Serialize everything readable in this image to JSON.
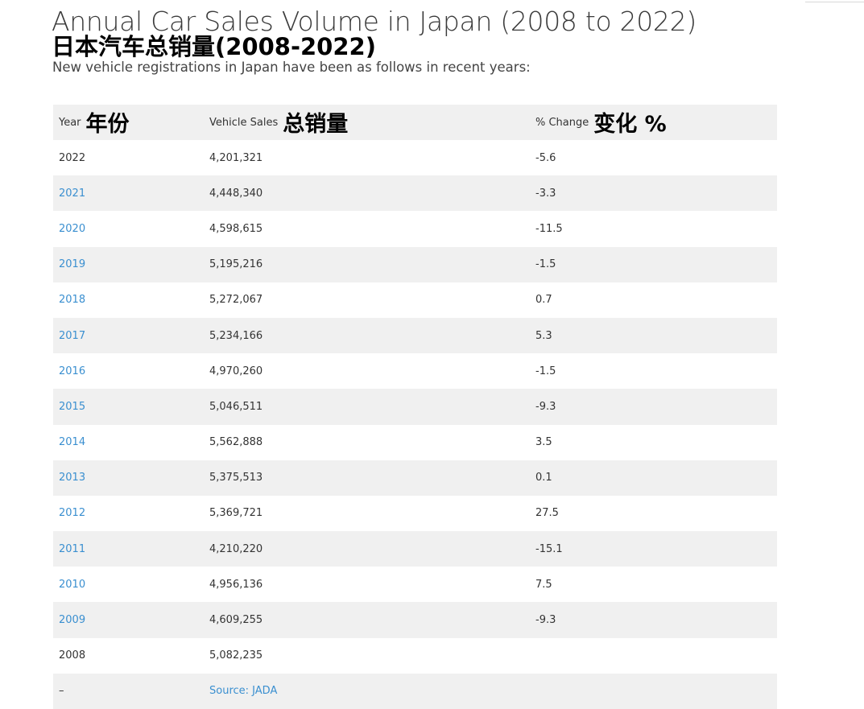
{
  "page": {
    "title": "Annual Car Sales Volume in Japan (2008 to 2022)",
    "title_cn": "日本汽车总销量(2008-2022)",
    "intro": "New vehicle registrations in Japan have been as follows in recent years:"
  },
  "table": {
    "headers": [
      {
        "en": "Year",
        "cn": "年份"
      },
      {
        "en": "Vehicle Sales",
        "cn": "总销量"
      },
      {
        "en": "% Change",
        "cn": "变化 %"
      }
    ],
    "rows": [
      {
        "year": "2022",
        "sales": "4,201,321",
        "change": "-5.6",
        "year_is_link": false
      },
      {
        "year": "2021",
        "sales": "4,448,340",
        "change": "-3.3",
        "year_is_link": true
      },
      {
        "year": "2020",
        "sales": "4,598,615",
        "change": "-11.5",
        "year_is_link": true
      },
      {
        "year": "2019",
        "sales": "5,195,216",
        "change": "-1.5",
        "year_is_link": true
      },
      {
        "year": "2018",
        "sales": "5,272,067",
        "change": "0.7",
        "year_is_link": true
      },
      {
        "year": "2017",
        "sales": "5,234,166",
        "change": "5.3",
        "year_is_link": true
      },
      {
        "year": "2016",
        "sales": "4,970,260",
        "change": "-1.5",
        "year_is_link": true
      },
      {
        "year": "2015",
        "sales": "5,046,511",
        "change": "-9.3",
        "year_is_link": true
      },
      {
        "year": "2014",
        "sales": "5,562,888",
        "change": "3.5",
        "year_is_link": true
      },
      {
        "year": "2013",
        "sales": "5,375,513",
        "change": "0.1",
        "year_is_link": true
      },
      {
        "year": "2012",
        "sales": "5,369,721",
        "change": "27.5",
        "year_is_link": true
      },
      {
        "year": "2011",
        "sales": "4,210,220",
        "change": "-15.1",
        "year_is_link": true
      },
      {
        "year": "2010",
        "sales": "4,956,136",
        "change": "7.5",
        "year_is_link": true
      },
      {
        "year": "2009",
        "sales": "4,609,255",
        "change": "-9.3",
        "year_is_link": true
      },
      {
        "year": "2008",
        "sales": "5,082,235",
        "change": "",
        "year_is_link": false
      }
    ],
    "footer": {
      "dash": "–",
      "source": "Source: JADA"
    }
  },
  "colors": {
    "link": "#3a8fd0",
    "stripe": "#f0f0f0",
    "text": "#333333"
  }
}
